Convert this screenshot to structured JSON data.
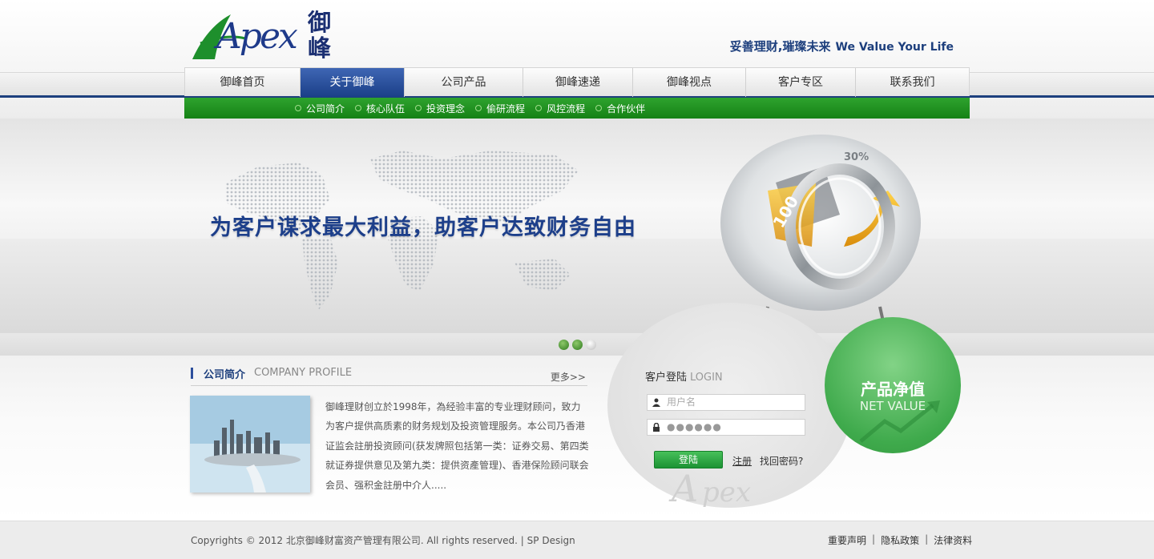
{
  "brand": {
    "logo_en": "Apex",
    "logo_cn": "御峰"
  },
  "slogan": {
    "cn": "妥善理财,璀璨未来",
    "en": "We Value Your Life"
  },
  "nav": {
    "items": [
      {
        "label": "御峰首页",
        "active": false
      },
      {
        "label": "关于御峰",
        "active": true
      },
      {
        "label": "公司产品",
        "active": false
      },
      {
        "label": "御峰速递",
        "active": false
      },
      {
        "label": "御峰视点",
        "active": false
      },
      {
        "label": "客户专区",
        "active": false
      },
      {
        "label": "联系我们",
        "active": false
      }
    ]
  },
  "subnav": {
    "items": [
      "公司简介",
      "核心队伍",
      "投资理念",
      "偷研流程",
      "风控流程",
      "合作伙伴"
    ]
  },
  "banner": {
    "title": "为客户谋求最大利益，助客户达致财务自由",
    "ring_labels": [
      "30%",
      "100",
      "%"
    ],
    "slides": {
      "count": 3,
      "active": 0
    }
  },
  "profile": {
    "title_cn": "公司简介",
    "title_en": "COMPANY PROFILE",
    "more": "更多>>",
    "text": "御峰理财创立於1998年，為经验丰富的专业理财顾问，致力为客户提供高质素的财务规划及投资管理服务。本公司乃香港证监会註册投资顾问(获发牌照包括第一类：证券交易、第四类就证券提供意见及第九类：提供资產管理)、香港保险顾问联会会员、强积金註册中介人....."
  },
  "login": {
    "title_cn": "客户登陆",
    "title_en": "LOGIN",
    "username_placeholder": "用户名",
    "password_value": "●●●●●●",
    "submit": "登陆",
    "register": "注册",
    "forgot": "找回密码?"
  },
  "net_value": {
    "cn": "产品净值",
    "en": "NET VALUE"
  },
  "footer": {
    "copyright": "Copyrights © 2012 北京御峰财富资产管理有限公司. All rights reserved. | SP Design",
    "links": [
      "重要声明",
      "隐私政策",
      "法律资料"
    ]
  },
  "colors": {
    "brand_blue": "#1d3f7d",
    "brand_green": "#1e8f2c"
  }
}
